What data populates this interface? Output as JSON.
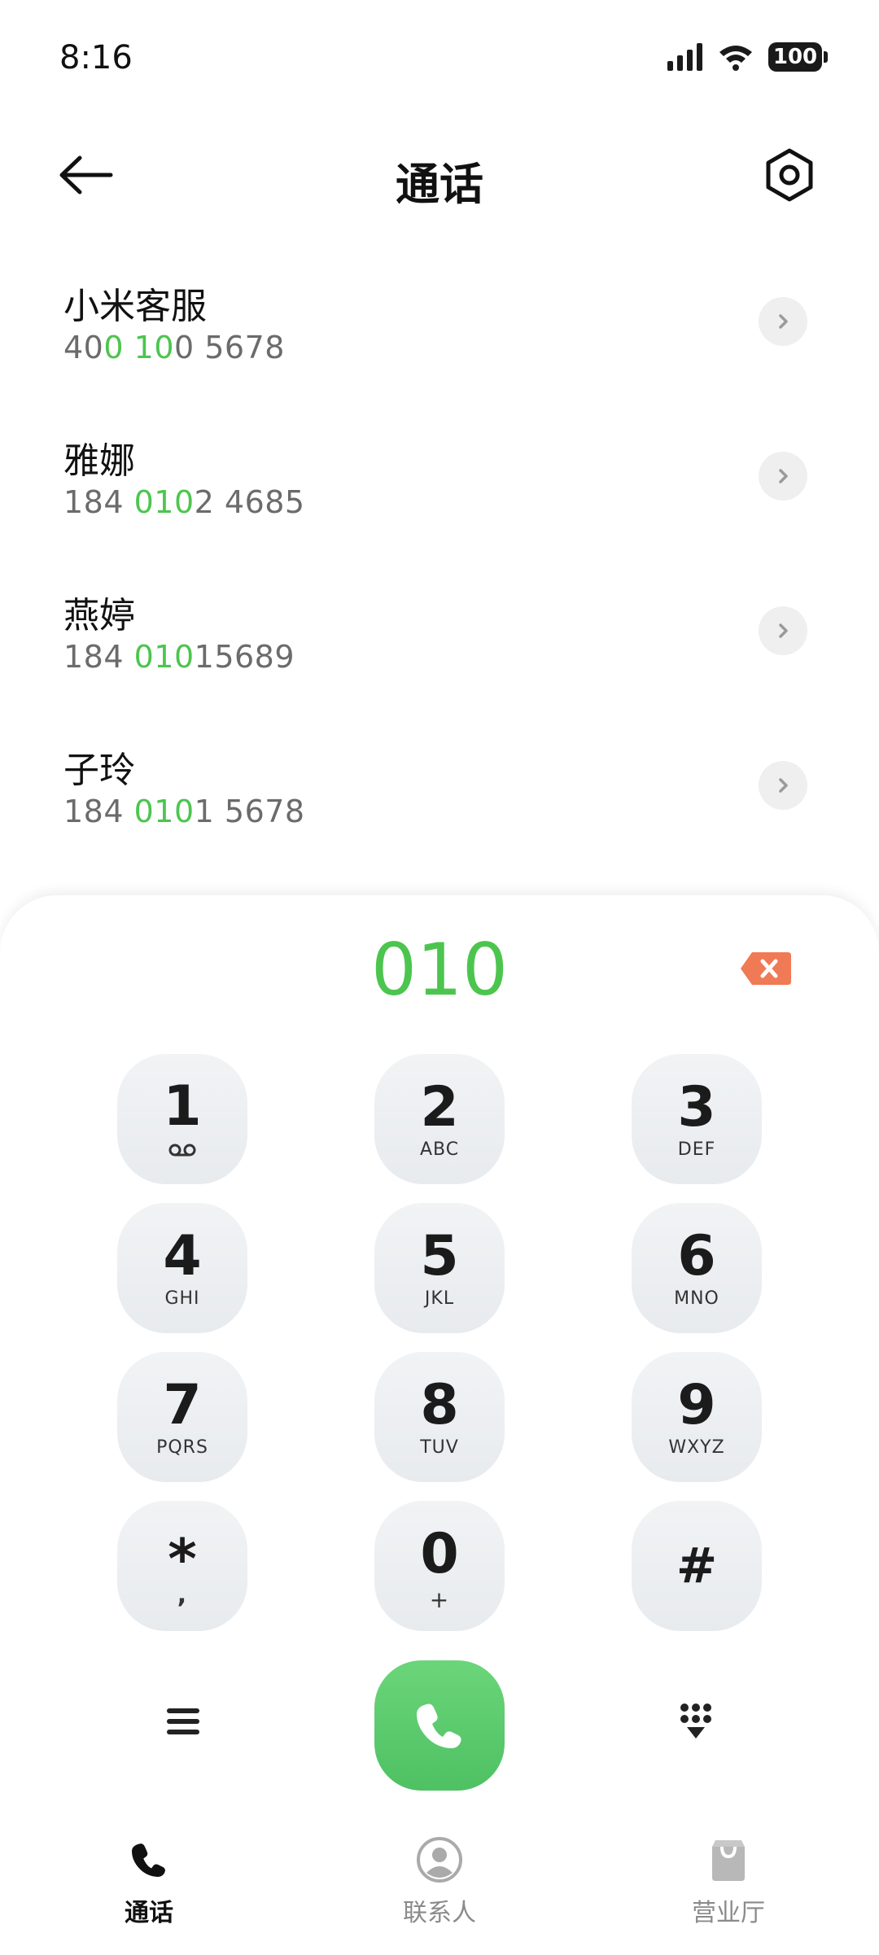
{
  "status": {
    "time": "8:16",
    "battery": "100"
  },
  "header": {
    "title": "通话"
  },
  "results": [
    {
      "name": "小米客服",
      "number_parts": [
        [
          "40",
          ""
        ],
        [
          "0",
          "hl"
        ],
        [
          " ",
          ""
        ],
        [
          "10",
          "hl"
        ],
        [
          "0 5678",
          ""
        ]
      ]
    },
    {
      "name": "雅娜",
      "number_parts": [
        [
          "184 ",
          ""
        ],
        [
          "010",
          "hl"
        ],
        [
          "2 4685",
          ""
        ]
      ]
    },
    {
      "name": "燕婷",
      "number_parts": [
        [
          "184 ",
          ""
        ],
        [
          "010",
          "hl"
        ],
        [
          "15689",
          ""
        ]
      ]
    },
    {
      "name": "子玲",
      "number_parts": [
        [
          "184 ",
          ""
        ],
        [
          "010",
          "hl"
        ],
        [
          "1 5678",
          ""
        ]
      ]
    }
  ],
  "dialer": {
    "input": "010",
    "keys": [
      {
        "digit": "1",
        "letters": "voicemail"
      },
      {
        "digit": "2",
        "letters": "ABC"
      },
      {
        "digit": "3",
        "letters": "DEF"
      },
      {
        "digit": "4",
        "letters": "GHI"
      },
      {
        "digit": "5",
        "letters": "JKL"
      },
      {
        "digit": "6",
        "letters": "MNO"
      },
      {
        "digit": "7",
        "letters": "PQRS"
      },
      {
        "digit": "8",
        "letters": "TUV"
      },
      {
        "digit": "9",
        "letters": "WXYZ"
      },
      {
        "digit": "*",
        "letters": ","
      },
      {
        "digit": "0",
        "letters": "+"
      },
      {
        "digit": "#",
        "letters": ""
      }
    ]
  },
  "nav": [
    {
      "label": "通话",
      "icon": "phone-icon",
      "active": true
    },
    {
      "label": "联系人",
      "icon": "contact-icon",
      "active": false
    },
    {
      "label": "营业厅",
      "icon": "shopping-bag-icon",
      "active": false
    }
  ],
  "colors": {
    "accent": "#4cc54f",
    "backspace": "#f07a55"
  }
}
